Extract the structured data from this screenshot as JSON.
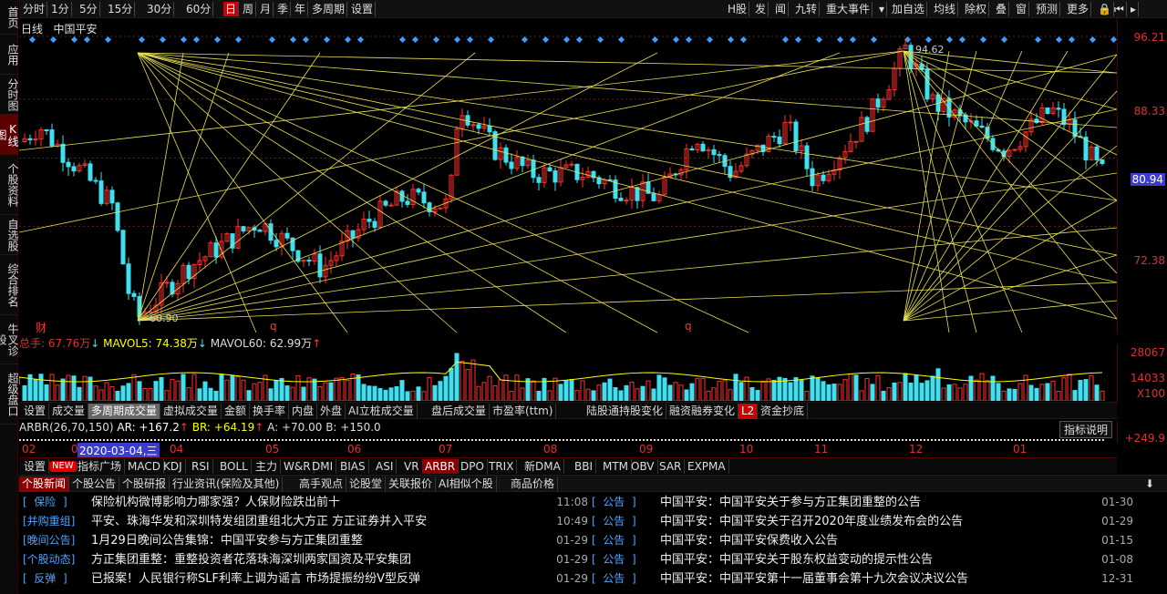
{
  "sidebar": [
    {
      "label": "首页",
      "on": false
    },
    {
      "label": "应用",
      "on": false
    },
    {
      "label": "分时图",
      "on": false
    },
    {
      "label": "K线图",
      "on": true
    },
    {
      "label": "个股资料",
      "on": false
    },
    {
      "label": "自选股",
      "on": false
    },
    {
      "label": "综合排名",
      "on": false
    },
    {
      "label": "牛叉诊股",
      "on": false
    },
    {
      "label": "超级盘口",
      "on": false
    }
  ],
  "periods": [
    "分时",
    "1分",
    "5分",
    "15分",
    "30分",
    "60分",
    "日",
    "周",
    "月",
    "季",
    "年",
    "多周期",
    "设置"
  ],
  "active_period": "日",
  "right_tools": [
    "H股",
    "发",
    "闻",
    "九转",
    "重大事件",
    "加自选",
    "均线",
    "除权",
    "叠",
    "窗",
    "预测",
    "更多"
  ],
  "chart": {
    "period_label": "日线",
    "stock_name": "中国平安",
    "high_label": "94.62",
    "low_label": "60.90",
    "cai": "财",
    "q1": "q",
    "q2": "q"
  },
  "price_axis": [
    {
      "v": "96.21"
    },
    {
      "v": "88.33"
    },
    {
      "v": "80.94",
      "hl": true
    },
    {
      "v": "72.38"
    }
  ],
  "volume": {
    "total": "总手: 67.76万",
    "mavol5": "MAVOL5: 74.38万",
    "mavol60": "MAVOL60: 62.99万",
    "axis": [
      "28067",
      "14033",
      "X100"
    ]
  },
  "tabs1": [
    "设置",
    "成交量",
    "多周期成交量",
    "虚拟成交量",
    "金额",
    "换手率",
    "内盘",
    "外盘",
    "AI立桩成交量",
    "盘后成交量",
    "市盈率(ttm)",
    "陆股通持股变化",
    "融资融券变化",
    "L2",
    "资金抄底"
  ],
  "tabs1_active": "多周期成交量",
  "arbr": {
    "title": "ARBR(26,70,150)",
    "ar": "AR: +167.2",
    "br": "BR: +64.19",
    "a": "A: +70.00",
    "b": "B: +150.0",
    "explain": "指标说明",
    "axis": [
      "+249.9"
    ]
  },
  "dates": [
    "02",
    "03",
    "04",
    "05",
    "06",
    "07",
    "08",
    "09",
    "10",
    "11",
    "12",
    "01"
  ],
  "date_highlight": "2020-03-04,三",
  "tabs2": [
    "设置",
    "NEW",
    "指标广场",
    "MACD",
    "KDJ",
    "RSI",
    "BOLL",
    "主力",
    "W&R",
    "DMI",
    "BIAS",
    "ASI",
    "VR",
    "ARBR",
    "DPO",
    "TRIX",
    "新DMA",
    "BBI",
    "MTM",
    "OBV",
    "SAR",
    "EXPMA"
  ],
  "tabs2_active": "ARBR",
  "news_tabs": [
    "个股新闻",
    "个股公告",
    "个股研报",
    "行业资讯(保险及其他)",
    "高手观点",
    "论股堂",
    "关联报价",
    "AI相似个股",
    "商品价格"
  ],
  "news_left": [
    {
      "cat": "保险",
      "title": "保险机构微博影响力哪家强？人保财险跌出前十",
      "date": "11:08"
    },
    {
      "cat": "并购重组",
      "title": "平安、珠海华发和深圳特发组团重组北大方正 方正证券并入平安",
      "date": "10:49"
    },
    {
      "cat": "晚间公告",
      "title": "1月29日晚间公告集锦：中国平安参与方正集团重整",
      "date": "01-29"
    },
    {
      "cat": "个股动态",
      "title": "方正集团重整：重整投资者花落珠海深圳两家国资及平安集团",
      "date": "01-29"
    },
    {
      "cat": "反弹",
      "title": "已报案！人民银行称SLF利率上调为谣言 市场提振纷纷V型反弹",
      "date": "01-29"
    }
  ],
  "news_right": [
    {
      "cat": "公告",
      "title": "中国平安：中国平安关于参与方正集团重整的公告",
      "date": "01-30"
    },
    {
      "cat": "公告",
      "title": "中国平安：中国平安关于召开2020年度业绩发布会的公告",
      "date": "01-29"
    },
    {
      "cat": "公告",
      "title": "中国平安：中国平安保费收入公告",
      "date": "01-15"
    },
    {
      "cat": "公告",
      "title": "中国平安：中国平安关于股东权益变动的提示性公告",
      "date": "01-08"
    },
    {
      "cat": "公告",
      "title": "中国平安：中国平安第十一届董事会第十九次会议决议公告",
      "date": "12-31"
    }
  ],
  "colors": {
    "up": "#ff3030",
    "down": "#40e0f0",
    "gann": "#e8e050",
    "axis_red": "#e03030",
    "active_blue": "#3b3bd0"
  }
}
